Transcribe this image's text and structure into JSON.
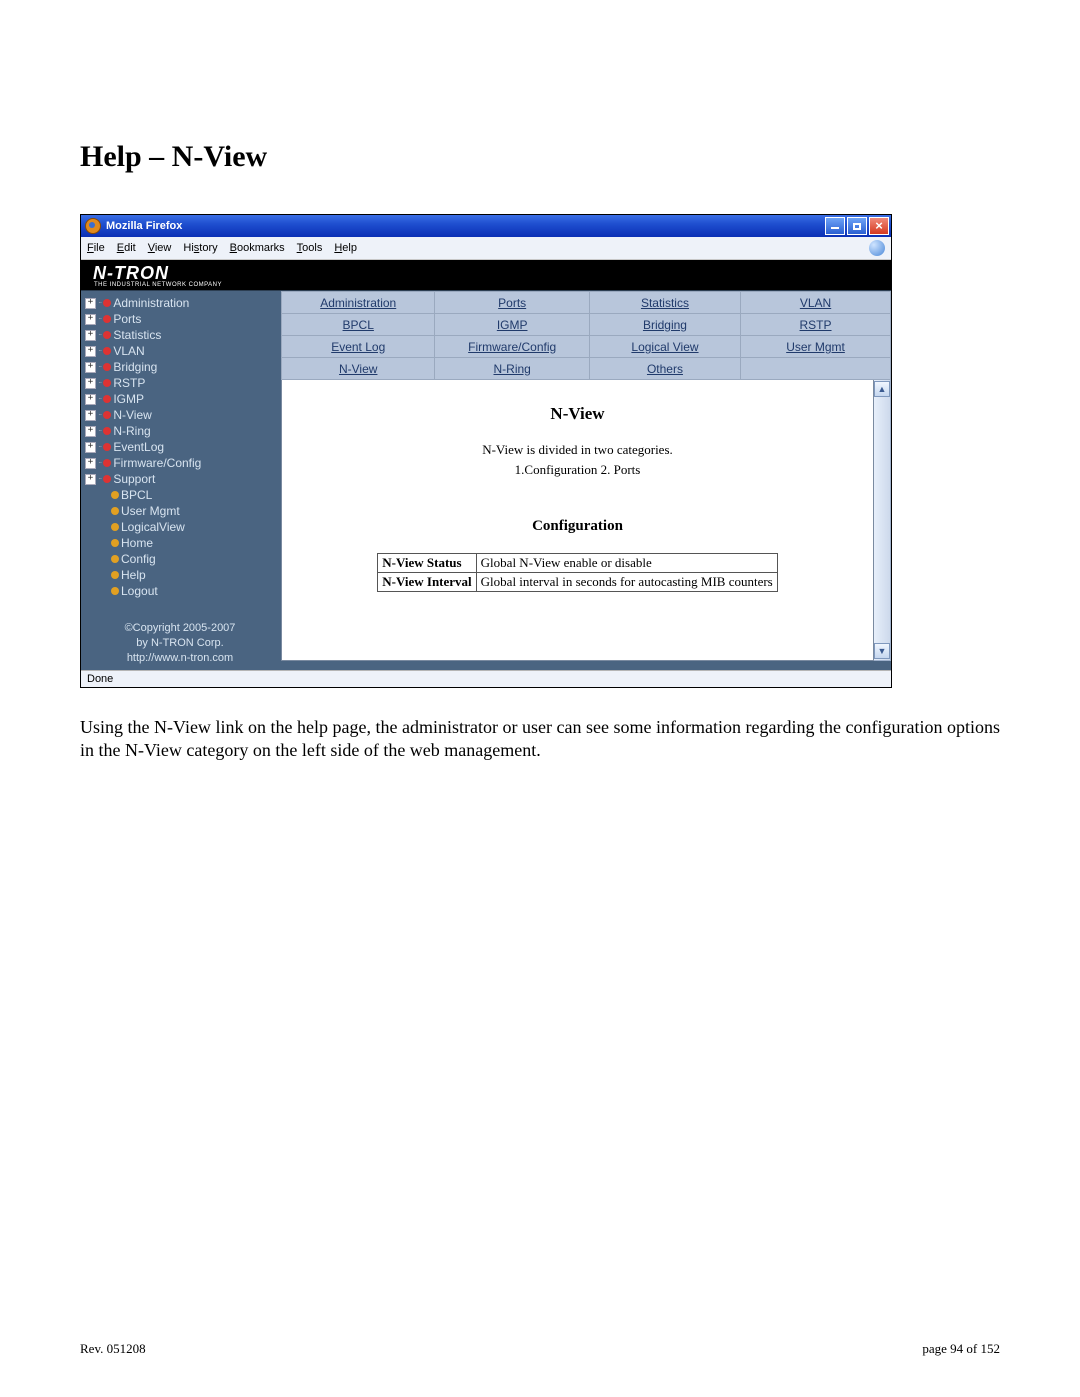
{
  "doc": {
    "heading": "Help – N-View",
    "paragraph": "Using the N-View link on the help page, the administrator or user can see some information regarding the configuration options in the N-View category on the left side of the web management.",
    "footer_left": "Rev.  051208",
    "footer_right": "page 94 of 152"
  },
  "browser": {
    "title": "Mozilla Firefox",
    "menu": [
      "File",
      "Edit",
      "View",
      "History",
      "Bookmarks",
      "Tools",
      "Help"
    ],
    "status": "Done"
  },
  "banner": {
    "logo": "N-TRON",
    "tagline": "THE INDUSTRIAL NETWORK COMPANY"
  },
  "sidebar": {
    "items": [
      {
        "exp": true,
        "bullet": "red",
        "label": "Administration"
      },
      {
        "exp": true,
        "bullet": "red",
        "label": "Ports"
      },
      {
        "exp": true,
        "bullet": "red",
        "label": "Statistics"
      },
      {
        "exp": true,
        "bullet": "red",
        "label": "VLAN"
      },
      {
        "exp": true,
        "bullet": "red",
        "label": "Bridging"
      },
      {
        "exp": true,
        "bullet": "red",
        "label": "RSTP"
      },
      {
        "exp": true,
        "bullet": "red",
        "label": "IGMP"
      },
      {
        "exp": true,
        "bullet": "red",
        "label": "N-View"
      },
      {
        "exp": true,
        "bullet": "red",
        "label": "N-Ring"
      },
      {
        "exp": true,
        "bullet": "red",
        "label": "EventLog"
      },
      {
        "exp": true,
        "bullet": "red",
        "label": "Firmware/Config"
      },
      {
        "exp": true,
        "bullet": "red",
        "label": "Support"
      },
      {
        "exp": false,
        "bullet": "orange",
        "label": "BPCL",
        "level": 2
      },
      {
        "exp": false,
        "bullet": "orange",
        "label": "User Mgmt",
        "level": 2
      },
      {
        "exp": false,
        "bullet": "orange",
        "label": "LogicalView",
        "level": 2
      },
      {
        "exp": false,
        "bullet": "orange",
        "label": "Home",
        "level": 2
      },
      {
        "exp": false,
        "bullet": "orange",
        "label": "Config",
        "level": 2
      },
      {
        "exp": false,
        "bullet": "orange",
        "label": "Help",
        "level": 2
      },
      {
        "exp": false,
        "bullet": "orange",
        "label": "Logout",
        "level": 2
      }
    ],
    "copyright_l1": "©Copyright 2005-2007",
    "copyright_l2": "by N-TRON Corp.",
    "copyright_l3": "http://www.n-tron.com"
  },
  "nav": {
    "r0": [
      "Administration",
      "Ports",
      "Statistics",
      "VLAN"
    ],
    "r1": [
      "BPCL",
      "IGMP",
      "Bridging",
      "RSTP"
    ],
    "r2": [
      "Event Log",
      "Firmware/Config",
      "Logical View",
      "User Mgmt"
    ],
    "r3": [
      "N-View",
      "N-Ring",
      "Others",
      ""
    ]
  },
  "content": {
    "h1": "N-View",
    "desc1": "N-View is divided in two categories.",
    "desc2": "1.Configuration   2. Ports",
    "h2": "Configuration",
    "table": [
      {
        "k": "N-View Status",
        "v": "Global N-View enable or disable"
      },
      {
        "k": "N-View Interval",
        "v": "Global interval in seconds for autocasting MIB counters"
      }
    ]
  }
}
